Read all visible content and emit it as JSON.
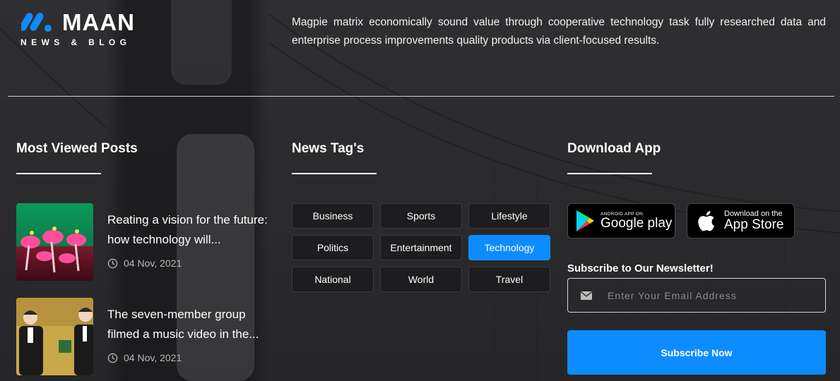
{
  "brand": {
    "name": "MAAN",
    "tagline": "NEWS & BLOG",
    "accent": "#0d8cff"
  },
  "intro_text": "Magpie matrix economically sound value through cooperative technology task fully researched data and enterprise process improvements quality products via client-focused results.",
  "most_viewed": {
    "title": "Most Viewed Posts",
    "posts": [
      {
        "title": "Reating a vision for the future: how technology will...",
        "date": "04 Nov, 2021",
        "icon": "clock-icon"
      },
      {
        "title": "The seven-member group filmed a music video in the...",
        "date": "04 Nov, 2021",
        "icon": "clock-icon"
      }
    ]
  },
  "news_tags": {
    "title": "News Tag's",
    "tags": [
      "Business",
      "Sports",
      "Lifestyle",
      "Politics",
      "Entertainment",
      "Technology",
      "National",
      "World",
      "Travel"
    ],
    "active": "Technology"
  },
  "download_app": {
    "title": "Download App",
    "google_play": {
      "small": "ANDROID APP ON",
      "big": "Google play",
      "icon": "google-play-icon"
    },
    "app_store": {
      "small": "Download on the",
      "big": "App Store",
      "icon": "apple-icon"
    }
  },
  "newsletter": {
    "label": "Subscribe to Our Newsletter!",
    "placeholder": "Enter Your Email Address",
    "icon": "envelope-icon",
    "button": "Subscribe Now"
  }
}
